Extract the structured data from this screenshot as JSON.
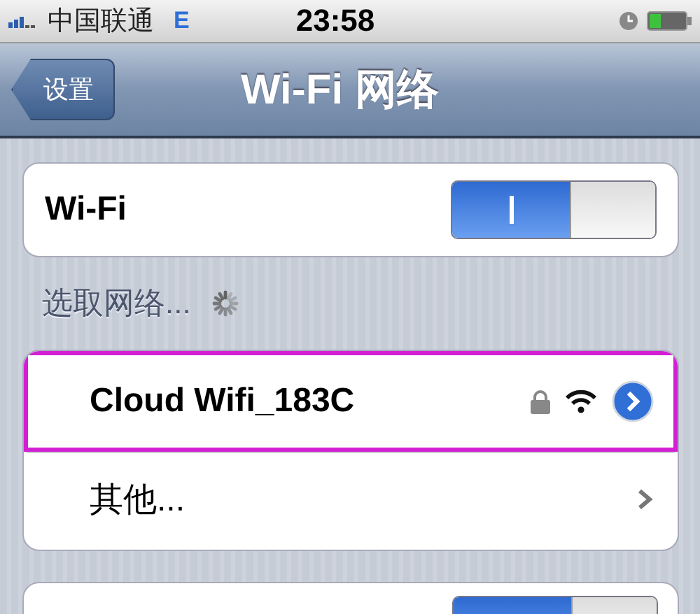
{
  "status_bar": {
    "carrier": "中国联通",
    "network": "E",
    "time": "23:58"
  },
  "nav_bar": {
    "back": "设置",
    "title": "Wi-Fi 网络"
  },
  "wifi_switch": {
    "label": "Wi-Fi",
    "on": true
  },
  "section_header": {
    "label": "选取网络...",
    "loading": true
  },
  "networks": [
    {
      "kind": "network",
      "name": "Cloud Wifi_183C",
      "locked": true,
      "highlighted": true
    },
    {
      "kind": "other",
      "name": "其他...",
      "highlighted": false
    }
  ],
  "lower_card": {
    "toggle_on": true
  }
}
